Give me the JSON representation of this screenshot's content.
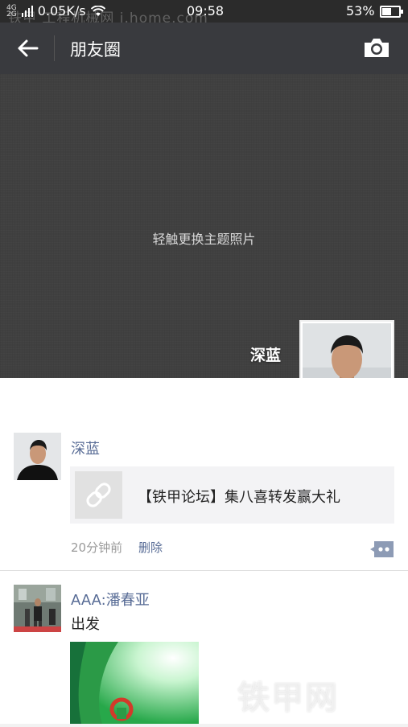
{
  "status_bar": {
    "network_top": "4G",
    "network_bottom": "2G",
    "speed": "0.05K/s",
    "time": "09:58",
    "battery": "53%",
    "battery_level": 0.53
  },
  "watermark": {
    "top_text": "铁甲 工程机械网 i.home.com",
    "bottom_text": "铁甲网"
  },
  "header": {
    "title": "朋友圈",
    "back_icon": "arrow-left-icon",
    "camera_icon": "camera-icon"
  },
  "cover": {
    "hint": "轻触更换主题照片",
    "profile_name": "深蓝"
  },
  "posts": [
    {
      "author": "深蓝",
      "link_title": "【铁甲论坛】集八喜转发赢大礼",
      "time": "20分钟前",
      "delete_label": "删除",
      "link_icon": "link-icon",
      "comment_icon": "comment-icon"
    },
    {
      "author": "AAA:潘春亚",
      "text": "出发"
    }
  ],
  "colors": {
    "name_blue": "#576b95",
    "titlebar": "#393a3e",
    "cover": "#404040"
  }
}
